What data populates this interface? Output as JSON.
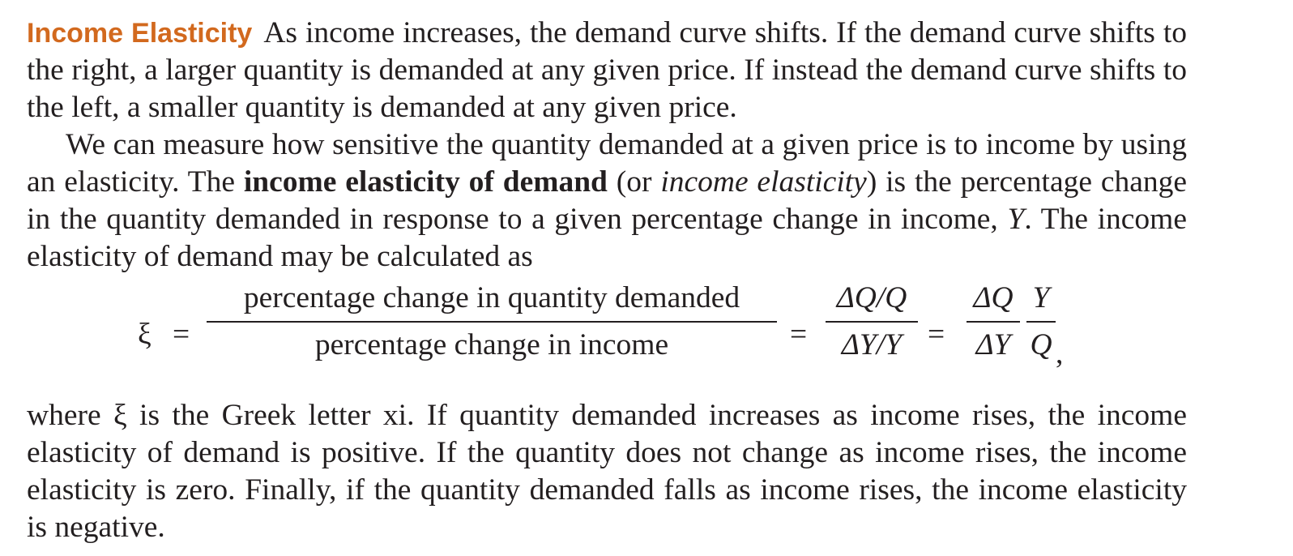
{
  "para1": {
    "heading": "Income Elasticity",
    "text": "As income increases, the demand curve shifts. If the demand curve shifts to the right, a larger quantity is demanded at any given price. If instead the demand curve shifts to the left, a smaller quantity is demanded at any given price."
  },
  "para2": {
    "text1": "We can measure how sensitive the quantity demanded at a given price is to income by using an elasticity. The ",
    "term": "income elasticity of demand",
    "text2": " (or ",
    "term_italic": "income elasticity",
    "text3": ") is the percentage change in the quantity demanded in response to a given percentage change in income, ",
    "var_y": "Y",
    "text4": ". The income elasticity of demand may be calculated as"
  },
  "equation": {
    "symbol": "ξ",
    "equals": "=",
    "frac1_num": "percentage change in quantity demanded",
    "frac1_den": "percentage change in income",
    "frac2_num": "ΔQ/Q",
    "frac2_den": "ΔY/Y",
    "frac3_num": "ΔQ",
    "frac3_den": "ΔY",
    "frac4_num": "Y",
    "frac4_den": "Q",
    "trailing": ","
  },
  "para3": {
    "text": "where ξ is the Greek letter xi. If quantity demanded increases as income rises, the income elasticity of demand is positive. If the quantity does not change as income rises, the income elasticity is zero. Finally, if the quantity demanded falls as income rises, the income elasticity is negative."
  }
}
